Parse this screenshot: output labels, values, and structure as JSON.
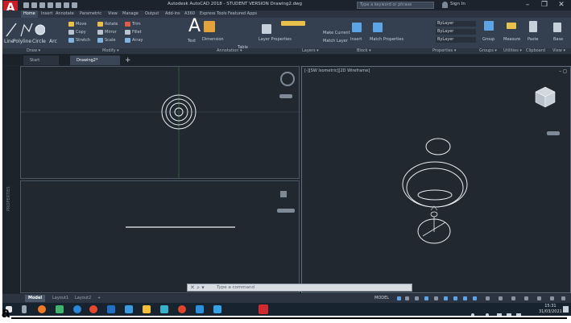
{
  "app": {
    "title": "Autodesk AutoCAD 2018 - STUDENT VERSION    Drawing2.dwg",
    "logo_letter": "A",
    "search_placeholder": "Type a keyword or phrase",
    "sign_in": "Sign In"
  },
  "menu_tabs": [
    "Home",
    "Insert",
    "Annotate",
    "Parametric",
    "View",
    "Manage",
    "Output",
    "Add-ins",
    "A360",
    "Express Tools",
    "Featured Apps"
  ],
  "ribbon": {
    "draw": [
      "Line",
      "Polyline",
      "Circle",
      "Arc"
    ],
    "modify": [
      "Move",
      "Rotate",
      "Trim",
      "Copy",
      "Mirror",
      "Fillet",
      "Stretch",
      "Scale",
      "Array"
    ],
    "annotation": [
      "Text",
      "Dimension",
      "Table"
    ],
    "layers": [
      "Layer Properties",
      "Make Current",
      "Match Layer"
    ],
    "block": [
      "Insert"
    ],
    "properties": [
      "Match Properties",
      "ByLayer",
      "ByLayer",
      "ByLayer"
    ],
    "groups": [
      "Group"
    ],
    "utilities": [
      "Measure"
    ],
    "clipboard": [
      "Paste",
      "Base"
    ],
    "panel_titles": [
      "Draw ▾",
      "Modify ▾",
      "Annotation ▾",
      "Layers ▾",
      "Block ▾",
      "Properties ▾",
      "Groups ▾",
      "Utilities ▾",
      "Clipboard",
      "View ▾"
    ]
  },
  "file_tabs": {
    "start": "Start",
    "drawing": "Drawing2*",
    "new": "+"
  },
  "viewports": {
    "right_label": "[-][SW Isometric][2D Wireframe]"
  },
  "left_strip_label": "PROPERTIES",
  "command": {
    "prompt": "Type a command"
  },
  "layout_tabs": [
    "Model",
    "Layout1",
    "Layout2",
    "+"
  ],
  "status": {
    "model": "MODEL"
  },
  "taskbar": {
    "time": "15:31",
    "date": "31/03/2021"
  },
  "caption": {
    "letter": "a"
  }
}
